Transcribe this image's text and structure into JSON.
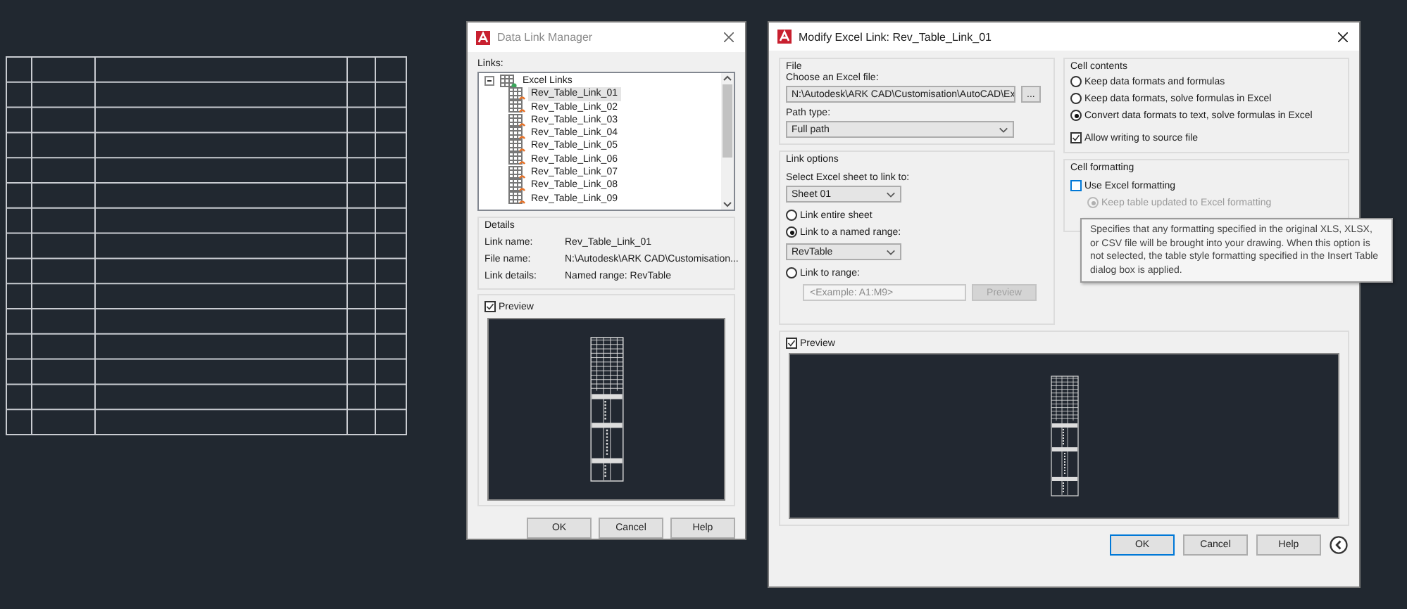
{
  "data_link_manager": {
    "title": "Data Link Manager",
    "links_label": "Links:",
    "tree": {
      "label": "Excel Links",
      "expanded": true,
      "children": [
        {
          "label": "Rev_Table_Link_01",
          "selected": true
        },
        {
          "label": "Rev_Table_Link_02",
          "selected": false
        },
        {
          "label": "Rev_Table_Link_03",
          "selected": false
        },
        {
          "label": "Rev_Table_Link_04",
          "selected": false
        },
        {
          "label": "Rev_Table_Link_05",
          "selected": false
        },
        {
          "label": "Rev_Table_Link_06",
          "selected": false
        },
        {
          "label": "Rev_Table_Link_07",
          "selected": false
        },
        {
          "label": "Rev_Table_Link_08",
          "selected": false
        },
        {
          "label": "Rev_Table_Link_09",
          "selected": false
        }
      ]
    },
    "details": {
      "title": "Details",
      "rows": [
        {
          "label": "Link name:",
          "value": "Rev_Table_Link_01"
        },
        {
          "label": "File name:",
          "value": "N:\\Autodesk\\ARK CAD\\Customisation..."
        },
        {
          "label": "Link details:",
          "value": "Named range: RevTable"
        }
      ]
    },
    "preview": {
      "label": "Preview",
      "checked": true
    },
    "buttons": [
      {
        "label": "OK",
        "default": false
      },
      {
        "label": "Cancel",
        "default": false
      },
      {
        "label": "Help",
        "default": false
      }
    ]
  },
  "modify_excel_link": {
    "title": "Modify Excel Link: Rev_Table_Link_01",
    "file": {
      "title": "File",
      "choose_label": "Choose an Excel file:",
      "file_value": "N:\\Autodesk\\ARK CAD\\Customisation\\AutoCAD\\Ex",
      "browse_button": "...",
      "path_type_label": "Path type:",
      "path_type_value": "Full path"
    },
    "link_options": {
      "title": "Link options",
      "sheet_label": "Select Excel sheet to link to:",
      "sheet_value": "Sheet 01",
      "options": [
        {
          "kind": "plain",
          "label": "Link entire sheet",
          "selected": false
        },
        {
          "kind": "dropdown",
          "label": "Link to a named range:",
          "selected": true,
          "value": "RevTable"
        },
        {
          "kind": "range",
          "label": "Link to range:",
          "selected": false,
          "placeholder": "<Example: A1:M9>",
          "button": {
            "label": "Preview",
            "disabled": true
          }
        }
      ]
    },
    "cell_contents": {
      "title": "Cell contents",
      "options": [
        {
          "label": "Keep data formats and formulas",
          "selected": false
        },
        {
          "label": "Keep data formats, solve formulas in Excel",
          "selected": false
        },
        {
          "label": "Convert data formats to text, solve formulas in Excel",
          "selected": true
        }
      ],
      "allow_writing": {
        "label": "Allow writing to source file",
        "checked": true
      }
    },
    "cell_formatting": {
      "title": "Cell formatting",
      "use_excel": {
        "label": "Use Excel formatting",
        "checked": false
      },
      "keep_updated": {
        "label": "Keep table updated to Excel formatting",
        "selected": true,
        "disabled": true
      }
    },
    "tooltip": {
      "text": "Specifies that any formatting specified in the original XLS, XLSX, or CSV file will be brought into your drawing. When this option is not selected, the table style formatting specified in the Insert Table dialog box is applied."
    },
    "preview": {
      "label": "Preview",
      "checked": true
    },
    "buttons": [
      {
        "label": "OK",
        "default": true
      },
      {
        "label": "Cancel",
        "default": false
      },
      {
        "label": "Help",
        "default": false
      }
    ]
  }
}
